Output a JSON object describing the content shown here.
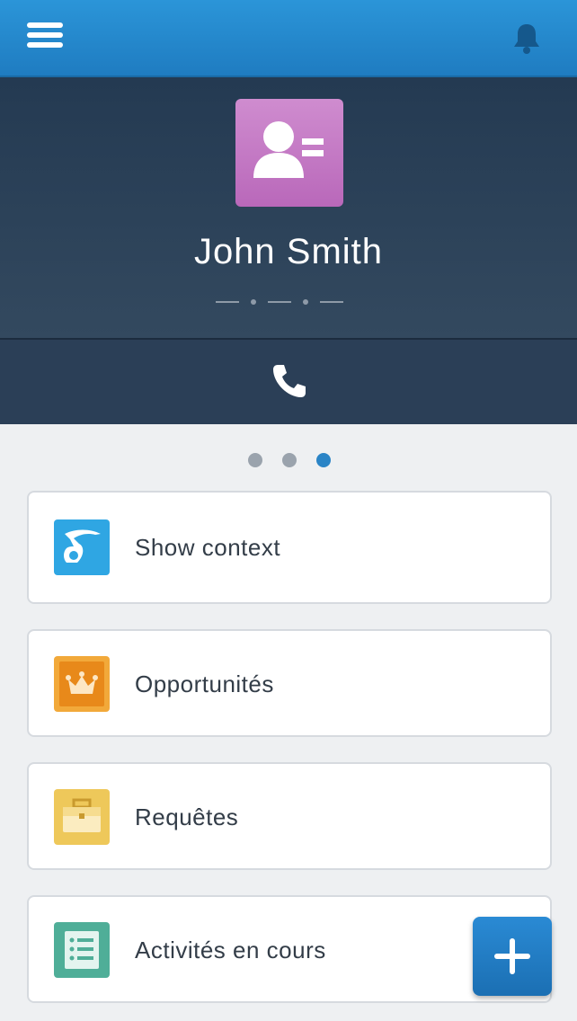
{
  "contact": {
    "name": "John Smith",
    "subtitle_placeholder": "— • — • —"
  },
  "pager": {
    "count": 3,
    "active_index": 2
  },
  "actions": [
    {
      "label": "Show context",
      "icon": "bird-context-icon"
    },
    {
      "label": "Opportunités",
      "icon": "crown-icon"
    },
    {
      "label": "Requêtes",
      "icon": "briefcase-icon"
    },
    {
      "label": "Activités en cours",
      "icon": "list-icon"
    }
  ],
  "colors": {
    "topbar": "#2b95d8",
    "header": "#2d435b",
    "accent": "#2a84c6",
    "contact_icon": "#c37ac4",
    "context_icon": "#2fa6e3",
    "opportunities_icon": "#f2a93a",
    "requests_icon": "#eec85a",
    "activities_icon": "#4fae98"
  },
  "icons": {
    "menu": "hamburger-icon",
    "notifications": "bell-icon",
    "contact": "contact-card-icon",
    "call": "phone-icon",
    "add": "plus-icon"
  }
}
